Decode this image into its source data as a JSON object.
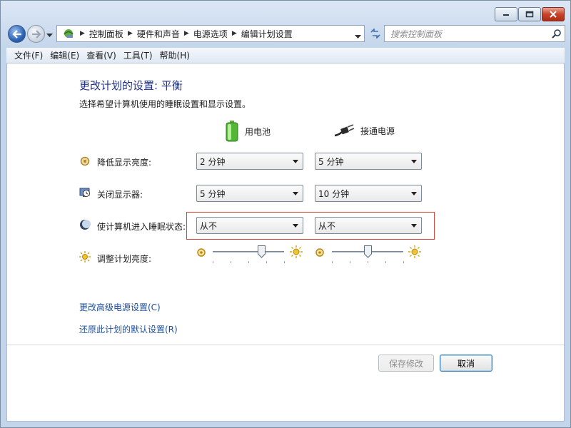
{
  "window": {
    "caption_buttons": [
      "minimize-icon",
      "maximize-icon",
      "close-icon"
    ]
  },
  "nav": {
    "breadcrumbs": [
      "控制面板",
      "硬件和声音",
      "电源选项",
      "编辑计划设置"
    ],
    "search_placeholder": "搜索控制面板"
  },
  "menu": {
    "items": [
      "文件(F)",
      "编辑(E)",
      "查看(V)",
      "工具(T)",
      "帮助(H)"
    ]
  },
  "main": {
    "title": "更改计划的设置: 平衡",
    "subtitle": "选择希望计算机使用的睡眠设置和显示设置。",
    "columns": {
      "battery": "用电池",
      "plugged": "接通电源"
    },
    "rows": [
      {
        "label": "降低显示亮度:",
        "battery": "2 分钟",
        "plugged": "5 分钟"
      },
      {
        "label": "关闭显示器:",
        "battery": "5 分钟",
        "plugged": "10 分钟"
      },
      {
        "label": "使计算机进入睡眠状态:",
        "battery": "从不",
        "plugged": "从不"
      }
    ],
    "brightness": {
      "label": "调整计划亮度:",
      "battery_level": 0.68,
      "plugged_level": 0.5
    },
    "links": {
      "advanced": "更改高级电源设置(C)",
      "restore": "还原此计划的默认设置(R)"
    },
    "buttons": {
      "save": "保存修改",
      "cancel": "取消"
    }
  },
  "colors": {
    "title": "#1e3287",
    "link": "#1c4f9e",
    "highlight_border": "#d9443a"
  }
}
